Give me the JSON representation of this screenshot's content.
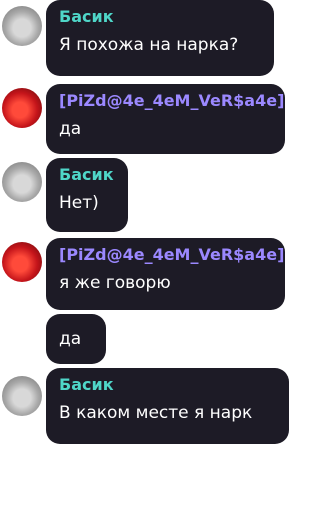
{
  "messages": [
    {
      "author": "Басик",
      "author_color": "#4fd6c8",
      "text": "Я похожа на нарка?",
      "avatar": "cat-avatar"
    },
    {
      "author": "[PiZd@4e_4eM_VeR$a4e]",
      "author_color": "#9b88ff",
      "text": "да",
      "avatar": "red-car-avatar"
    },
    {
      "author": "Басик",
      "author_color": "#4fd6c8",
      "text": "Нет)",
      "avatar": "cat-avatar"
    },
    {
      "author": "[PiZd@4e_4eM_VeR$a4e]",
      "author_color": "#9b88ff",
      "text": "я же говорю",
      "avatar": "red-car-avatar"
    },
    {
      "text": "да"
    },
    {
      "author": "Басик",
      "author_color": "#4fd6c8",
      "text": "В каком месте я нарк",
      "avatar": "cat-avatar"
    }
  ]
}
